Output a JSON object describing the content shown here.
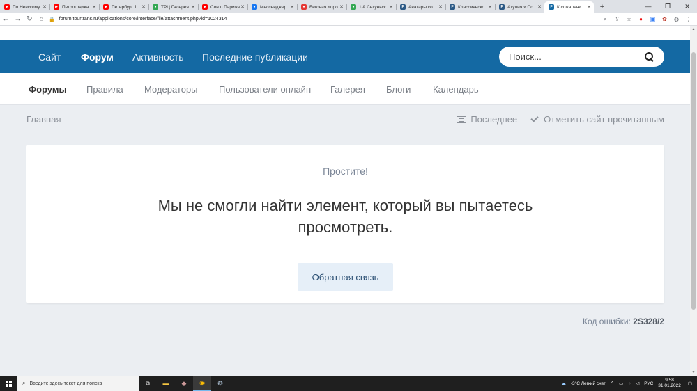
{
  "browser": {
    "tabs": [
      {
        "title": "По Невскому",
        "color": "#ff0000",
        "glyph": "▶"
      },
      {
        "title": "Петроградка",
        "color": "#ff0000",
        "glyph": "▶"
      },
      {
        "title": "Петербург 1",
        "color": "#ff0000",
        "glyph": "▶"
      },
      {
        "title": "ТРЦ Галерея",
        "color": "#34a853",
        "glyph": "●"
      },
      {
        "title": "Сон о Париже",
        "color": "#ff0000",
        "glyph": "▶"
      },
      {
        "title": "Мессенджер",
        "color": "#1877f2",
        "glyph": "●"
      },
      {
        "title": "Беговая доро",
        "color": "#e53935",
        "glyph": "●"
      },
      {
        "title": "1-й Сетуньск",
        "color": "#34a853",
        "glyph": "●"
      },
      {
        "title": "Аватары со",
        "color": "#2a5885",
        "glyph": "F"
      },
      {
        "title": "Классическо",
        "color": "#2a5885",
        "glyph": "F"
      },
      {
        "title": "Атулия » Со",
        "color": "#2a5885",
        "glyph": "F"
      },
      {
        "title": "К сожалени",
        "color": "#1469a3",
        "glyph": "F"
      }
    ],
    "url": "forum.tourtrans.ru/applications/core/interface/file/attachment.php?id=1024314"
  },
  "nav": {
    "items": [
      "Сайт",
      "Форум",
      "Активность",
      "Последние публикации"
    ],
    "active_index": 1
  },
  "search": {
    "placeholder": "Поиск..."
  },
  "subnav": {
    "items": [
      "Форумы",
      "Правила",
      "Модераторы",
      "Пользователи онлайн",
      "Галерея",
      "Блоги",
      "Календарь"
    ]
  },
  "breadcrumb": {
    "home": "Главная"
  },
  "actions": {
    "latest": "Последнее",
    "mark_read": "Отметить сайт прочитанным"
  },
  "error": {
    "sorry": "Простите!",
    "message": "Мы не смогли найти элемент, который вы пытаетесь просмотреть.",
    "feedback_button": "Обратная связь",
    "code_label": "Код ошибки:",
    "code": "2S328/2"
  },
  "taskbar": {
    "search_placeholder": "Введите здесь текст для поиска",
    "weather": "-3°C  Легкий снег",
    "lang": "РУС",
    "time": "9:58",
    "date": "31.01.2022"
  },
  "colors": {
    "header_blue": "#1469a3",
    "page_bg": "#ebeef2"
  }
}
